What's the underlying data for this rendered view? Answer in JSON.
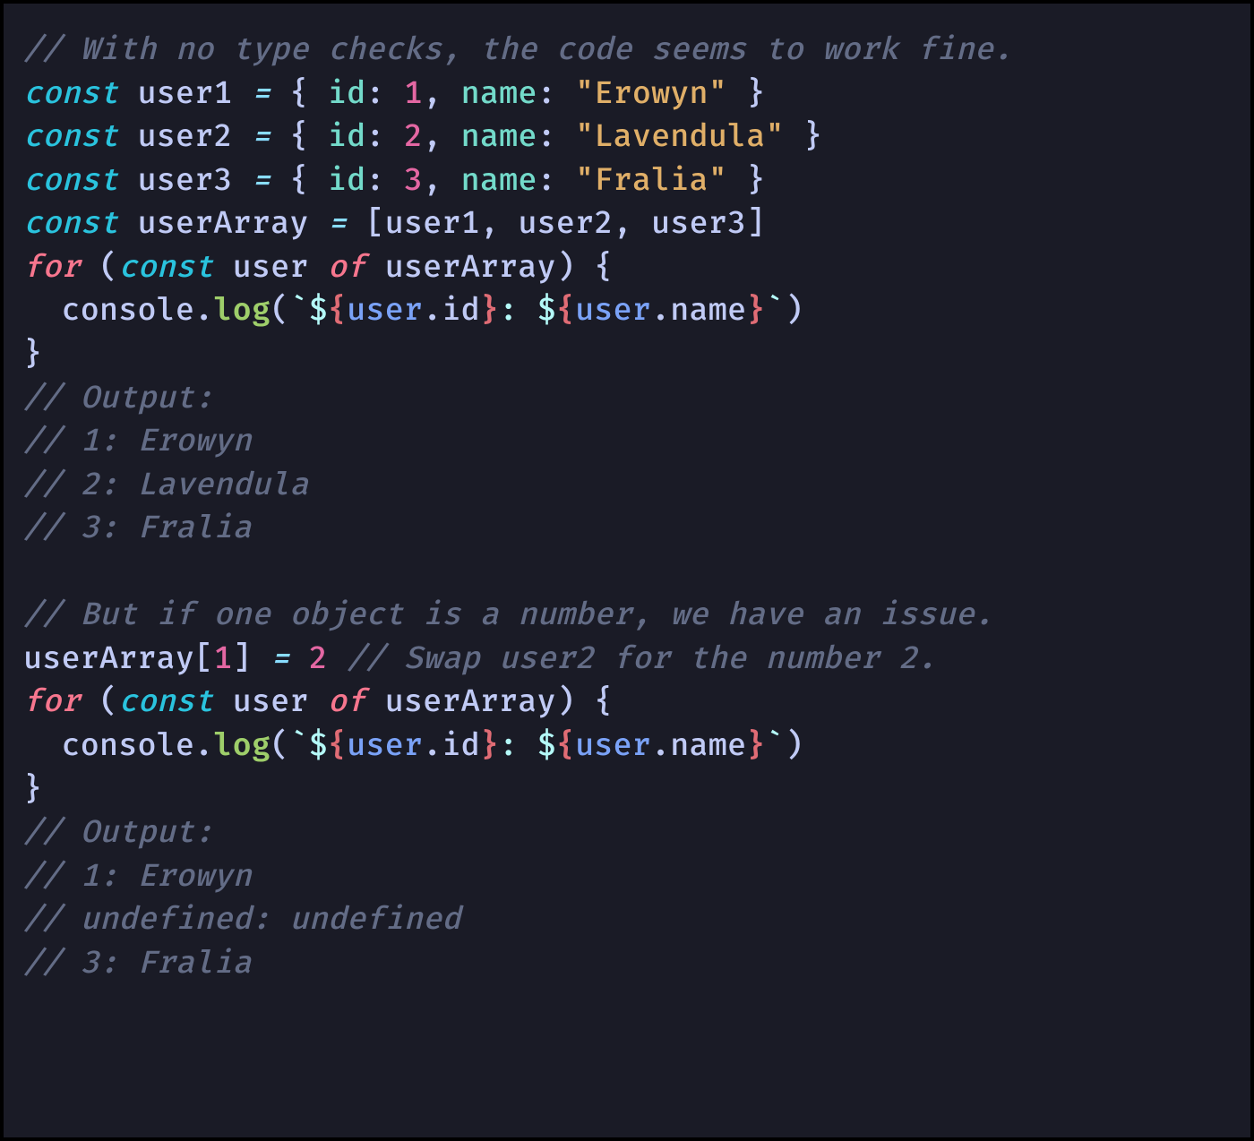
{
  "lines": {
    "c1": "// With no type checks, the code seems to work fine.",
    "kw_const": "const",
    "user1": "user1",
    "user2": "user2",
    "user3": "user3",
    "userArray": "userArray",
    "eq": "=",
    "lbrace": "{",
    "rbrace": "}",
    "lbrack": "[",
    "rbrack": "]",
    "lparen": "(",
    "rparen": ")",
    "key_id": "id",
    "key_name": "name",
    "colon": ":",
    "comma": ",",
    "n1": "1",
    "n2": "2",
    "n3": "3",
    "s_erowyn": "\"Erowyn\"",
    "s_lavendula": "\"Lavendula\"",
    "s_fralia": "\"Fralia\"",
    "kw_for": "for",
    "kw_of": "of",
    "user": "user",
    "console": "console",
    "dot": ".",
    "log": "log",
    "backtick": "`",
    "dollar": "$",
    "tlbrace": "{",
    "trbrace": "}",
    "prop_id": "id",
    "prop_name": "name",
    "tcolon": ": ",
    "c_output": "// Output:",
    "c_o1": "// 1: Erowyn",
    "c_o2": "// 2: Lavendula",
    "c_o3": "// 3: Fralia",
    "c2": "// But if one object is a number, we have an issue.",
    "c_swap": "// Swap user2 for the number 2.",
    "c_u1": "// 1: Erowyn",
    "c_undef": "// undefined: undefined",
    "c_u3": "// 3: Fralia"
  }
}
